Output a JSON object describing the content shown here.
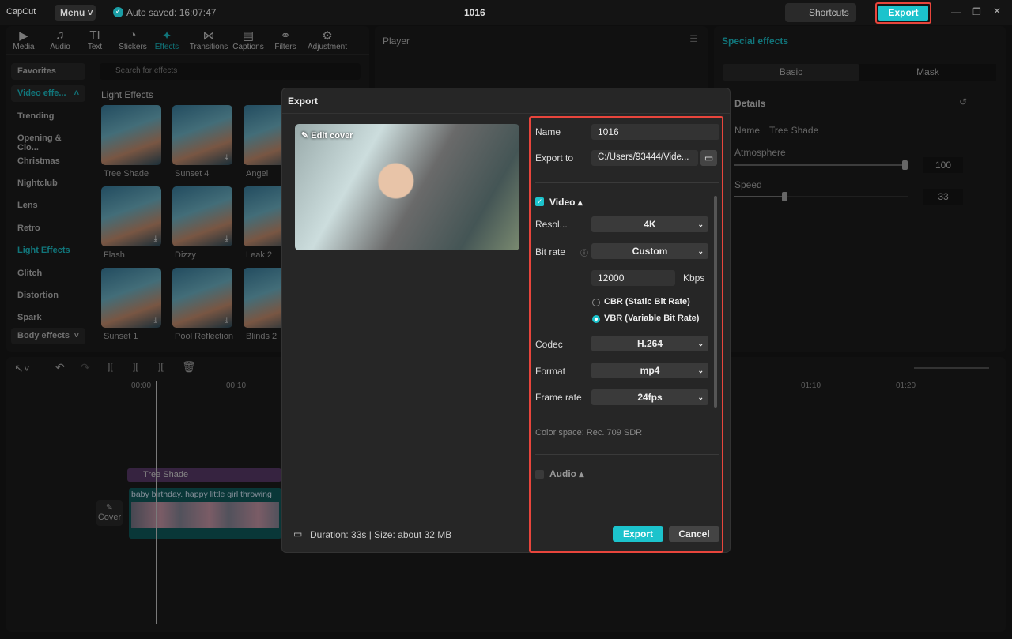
{
  "app": {
    "logo": "CapCut",
    "menu": "Menu",
    "autosave": "Auto saved: 16:07:47",
    "project": "1016",
    "shortcuts": "Shortcuts",
    "export": "Export"
  },
  "tabs": [
    {
      "icon": "▶",
      "label": "Media"
    },
    {
      "icon": "♫",
      "label": "Audio"
    },
    {
      "icon": "TI",
      "label": "Text"
    },
    {
      "icon": "◔",
      "label": "Stickers"
    },
    {
      "icon": "✦",
      "label": "Effects"
    },
    {
      "icon": "⋈",
      "label": "Transitions"
    },
    {
      "icon": "▤",
      "label": "Captions"
    },
    {
      "icon": "⚭",
      "label": "Filters"
    },
    {
      "icon": "⚙",
      "label": "Adjustment"
    }
  ],
  "sidebar": [
    "Favorites",
    "Video effe...",
    "Trending",
    "Opening & Clo...",
    "Christmas",
    "Nightclub",
    "Lens",
    "Retro",
    "Light Effects",
    "Glitch",
    "Distortion",
    "Spark",
    "Body effects"
  ],
  "search_placeholder": "Search for effects",
  "section": "Light Effects",
  "effects": [
    "Tree Shade",
    "Sunset 4",
    "Angel",
    "Flash",
    "Dizzy",
    "Leak 2",
    "Sunset 1",
    "Pool Reflection",
    "Blinds 2"
  ],
  "player": {
    "title": "Player"
  },
  "right": {
    "title": "Special effects",
    "tab_basic": "Basic",
    "tab_mask": "Mask",
    "details": "Details",
    "name_label": "Name",
    "name_value": "Tree Shade",
    "atmosphere": "Atmosphere",
    "atmosphere_value": "100",
    "speed": "Speed",
    "speed_value": "33"
  },
  "timeline": {
    "t0": "00:00",
    "t1": "00:10",
    "t2": "01:10",
    "t3": "01:20",
    "effect_clip": "Tree Shade",
    "video_clip": "baby birthday. happy little girl throwing",
    "cover": "Cover"
  },
  "dialog": {
    "title": "Export",
    "edit_cover": "Edit cover",
    "name_label": "Name",
    "name_value": "1016",
    "export_to_label": "Export to",
    "export_to_value": "C:/Users/93444/Vide...",
    "video": "Video",
    "resolution_label": "Resol...",
    "resolution": "4K",
    "bitrate_label": "Bit rate",
    "bitrate": "Custom",
    "kbps_value": "12000",
    "kbps": "Kbps",
    "cbr": "CBR (Static Bit Rate)",
    "vbr": "VBR (Variable Bit Rate)",
    "codec_label": "Codec",
    "codec": "H.264",
    "format_label": "Format",
    "format": "mp4",
    "framerate_label": "Frame rate",
    "framerate": "24fps",
    "colorspace": "Color space: Rec. 709 SDR",
    "audio": "Audio",
    "duration": "Duration: 33s | Size: about 32 MB",
    "export_btn": "Export",
    "cancel_btn": "Cancel"
  },
  "colors": {
    "accent": "#1cc3cc",
    "highlight": "#e8453c"
  }
}
